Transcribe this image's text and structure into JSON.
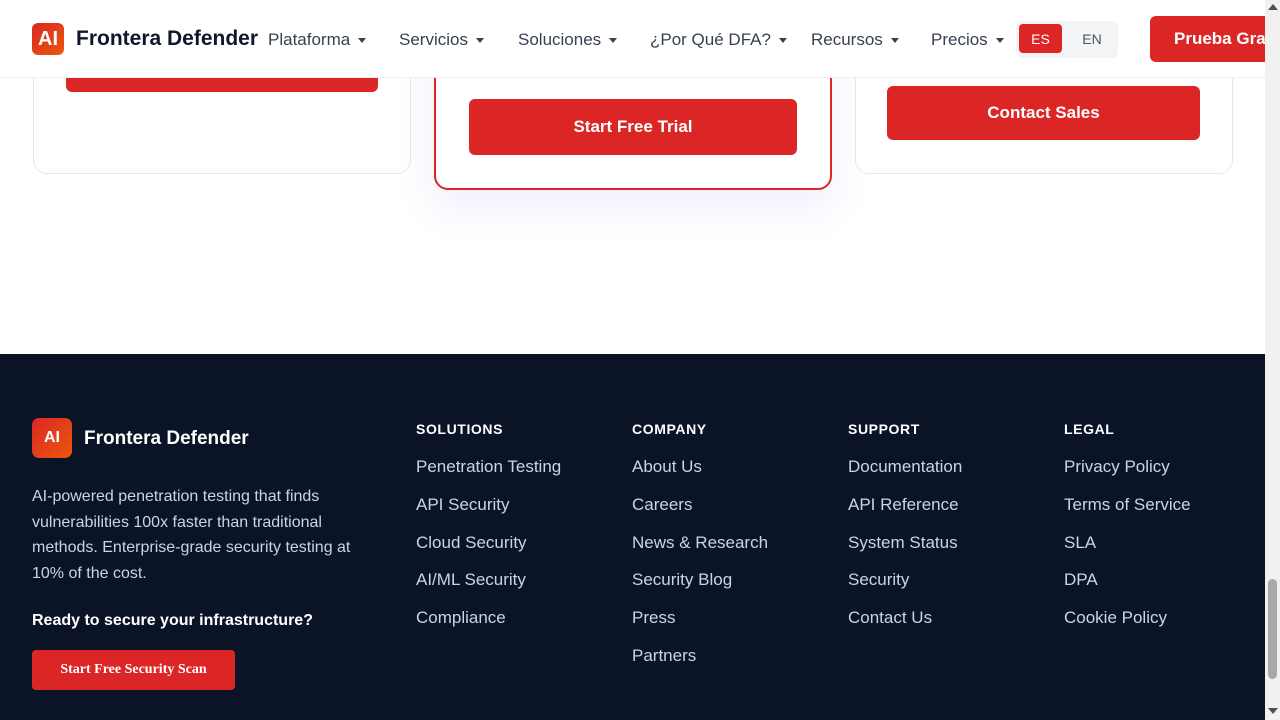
{
  "header": {
    "logo_text": "AI",
    "brand": "Frontera Defender",
    "nav": [
      "Plataforma",
      "Servicios",
      "Soluciones",
      "¿Por Qué DFA?",
      "Recursos",
      "Precios"
    ],
    "lang_es": "ES",
    "lang_en": "EN",
    "cta": "Prueba Gratis"
  },
  "pricing": {
    "left_button": "",
    "mid_button": "Start Free Trial",
    "right_button": "Contact Sales"
  },
  "footer": {
    "logo_text": "AI",
    "brand": "Frontera Defender",
    "description": "AI-powered penetration testing that finds vulnerabilities 100x faster than traditional methods. Enterprise-grade security testing at 10% of the cost.",
    "ready_text": "Ready to secure your infrastructure?",
    "cta": "Start Free Security Scan",
    "columns": [
      {
        "title": "SOLUTIONS",
        "links": [
          "Penetration Testing",
          "API Security",
          "Cloud Security",
          "AI/ML Security",
          "Compliance"
        ]
      },
      {
        "title": "COMPANY",
        "links": [
          "About Us",
          "Careers",
          "News & Research",
          "Security Blog",
          "Press",
          "Partners"
        ]
      },
      {
        "title": "SUPPORT",
        "links": [
          "Documentation",
          "API Reference",
          "System Status",
          "Security",
          "Contact Us"
        ]
      },
      {
        "title": "LEGAL",
        "links": [
          "Privacy Policy",
          "Terms of Service",
          "SLA",
          "DPA",
          "Cookie Policy"
        ]
      }
    ]
  },
  "colors": {
    "accent": "#dc2626",
    "footer_bg": "#0b1426",
    "text_dark": "#0f172a"
  }
}
